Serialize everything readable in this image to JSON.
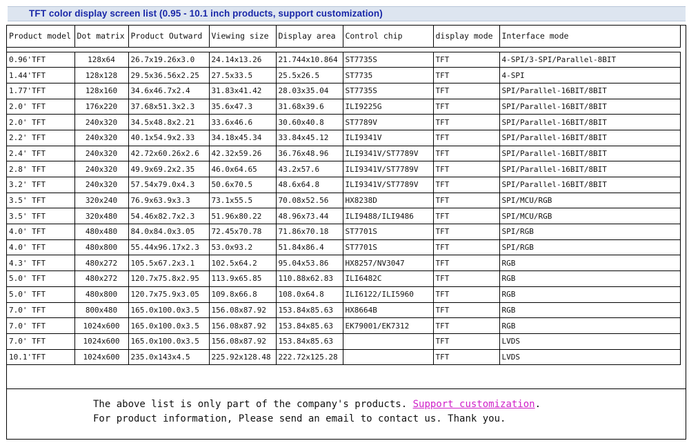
{
  "title": "TFT color display screen list  (0.95 - 10.1 inch products, support customization)",
  "table": {
    "headers": [
      "Product model",
      "Dot matrix",
      "Product Outward",
      "Viewing size",
      "Display area",
      "Control chip",
      "display mode",
      "Interface mode"
    ],
    "rows": [
      [
        "0.96'TFT",
        "128x64",
        "26.7x19.26x3.0",
        "24.14x13.26",
        "21.744x10.864",
        "ST7735S",
        "TFT",
        "4-SPI/3-SPI/Parallel-8BIT"
      ],
      [
        "1.44'TFT",
        "128x128",
        "29.5x36.56x2.25",
        "27.5x33.5",
        "25.5x26.5",
        "ST7735",
        "TFT",
        "4-SPI"
      ],
      [
        "1.77'TFT",
        "128x160",
        "34.6x46.7x2.4",
        "31.83x41.42",
        "28.03x35.04",
        "ST7735S",
        "TFT",
        "SPI/Parallel-16BIT/8BIT"
      ],
      [
        "2.0' TFT",
        "176x220",
        "37.68x51.3x2.3",
        "35.6x47.3",
        "31.68x39.6",
        "ILI9225G",
        "TFT",
        "SPI/Parallel-16BIT/8BIT"
      ],
      [
        "2.0' TFT",
        "240x320",
        "34.5x48.8x2.21",
        "33.6x46.6",
        "30.60x40.8",
        "ST7789V",
        "TFT",
        "SPI/Parallel-16BIT/8BIT"
      ],
      [
        "2.2' TFT",
        "240x320",
        "40.1x54.9x2.33",
        "34.18x45.34",
        "33.84x45.12",
        "ILI9341V",
        "TFT",
        "SPI/Parallel-16BIT/8BIT"
      ],
      [
        "2.4' TFT",
        "240x320",
        "42.72x60.26x2.6",
        "42.32x59.26",
        "36.76x48.96",
        "ILI9341V/ST7789V",
        "TFT",
        "SPI/Parallel-16BIT/8BIT"
      ],
      [
        "2.8' TFT",
        "240x320",
        "49.9x69.2x2.35",
        "46.0x64.65",
        "43.2x57.6",
        "ILI9341V/ST7789V",
        "TFT",
        "SPI/Parallel-16BIT/8BIT"
      ],
      [
        "3.2' TFT",
        "240x320",
        "57.54x79.0x4.3",
        "50.6x70.5",
        "48.6x64.8",
        "ILI9341V/ST7789V",
        "TFT",
        "SPI/Parallel-16BIT/8BIT"
      ],
      [
        "3.5' TFT",
        "320x240",
        "76.9x63.9x3.3",
        "73.1x55.5",
        "70.08x52.56",
        "HX8238D",
        "TFT",
        "SPI/MCU/RGB"
      ],
      [
        "3.5' TFT",
        "320x480",
        "54.46x82.7x2.3",
        "51.96x80.22",
        "48.96x73.44",
        "ILI9488/ILI9486",
        "TFT",
        "SPI/MCU/RGB"
      ],
      [
        "4.0' TFT",
        "480x480",
        "84.0x84.0x3.05",
        "72.45x70.78",
        "71.86x70.18",
        "ST7701S",
        "TFT",
        "SPI/RGB"
      ],
      [
        "4.0' TFT",
        "480x800",
        "55.44x96.17x2.3",
        "53.0x93.2",
        "51.84x86.4",
        "ST7701S",
        "TFT",
        "SPI/RGB"
      ],
      [
        "4.3' TFT",
        "480x272",
        "105.5x67.2x3.1",
        "102.5x64.2",
        "95.04x53.86",
        "HX8257/NV3047",
        "TFT",
        "RGB"
      ],
      [
        "5.0' TFT",
        "480x272",
        "120.7x75.8x2.95",
        "113.9x65.85",
        "110.88x62.83",
        "ILI6482C",
        "TFT",
        "RGB"
      ],
      [
        "5.0' TFT",
        "480x800",
        "120.7x75.9x3.05",
        "109.8x66.8",
        "108.0x64.8",
        "ILI6122/ILI5960",
        "TFT",
        "RGB"
      ],
      [
        "7.0' TFT",
        "800x480",
        "165.0x100.0x3.5",
        "156.08x87.92",
        "153.84x85.63",
        "HX8664B",
        "TFT",
        "RGB"
      ],
      [
        "7.0' TFT",
        "1024x600",
        "165.0x100.0x3.5",
        "156.08x87.92",
        "153.84x85.63",
        "EK79001/EK7312",
        "TFT",
        "RGB"
      ],
      [
        "7.0' TFT",
        "1024x600",
        "165.0x100.0x3.5",
        "156.08x87.92",
        "153.84x85.63",
        "",
        "TFT",
        "LVDS"
      ],
      [
        "10.1'TFT",
        "1024x600",
        "235.0x143x4.5",
        "225.92x128.48",
        "222.72x125.28",
        "",
        "TFT",
        "LVDS"
      ]
    ]
  },
  "footer": {
    "line1_prefix": "The above list is only part of the company's products. ",
    "link_text": "Support customization",
    "line1_suffix": ".",
    "line2": "For product information, Please send an email to contact us. Thank you."
  },
  "colors": {
    "title_text": "#1a28a8",
    "title_bar": "#dde5f0",
    "link": "#d020c8"
  }
}
